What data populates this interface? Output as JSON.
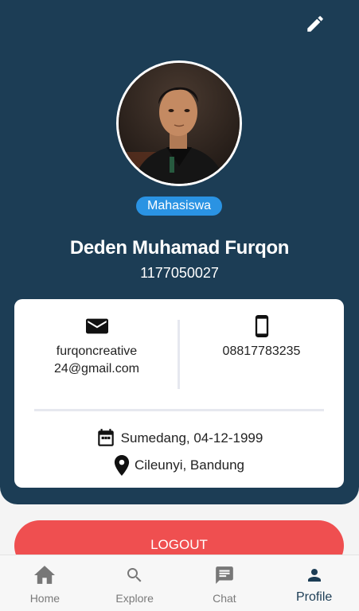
{
  "profile": {
    "role_badge": "Mahasiswa",
    "name": "Deden Muhamad Furqon",
    "student_id": "1177050027"
  },
  "contact": {
    "email": "furqoncreative24@gmail.com",
    "phone": "08817783235"
  },
  "details": {
    "birth": "Sumedang, 04-12-1999",
    "location": "Cileunyi, Bandung"
  },
  "actions": {
    "logout_label": "LOGOUT"
  },
  "bottom_nav": {
    "items": [
      {
        "label": "Home",
        "icon": "home-icon"
      },
      {
        "label": "Explore",
        "icon": "search-icon"
      },
      {
        "label": "Chat",
        "icon": "chat-icon"
      },
      {
        "label": "Profile",
        "icon": "person-icon",
        "active": true
      }
    ]
  },
  "colors": {
    "header": "#1c3d55",
    "badge": "#2a93e3",
    "logout": "#ef4f50",
    "nav_active": "#1c3d55",
    "nav_inactive": "#7a7a7a"
  }
}
